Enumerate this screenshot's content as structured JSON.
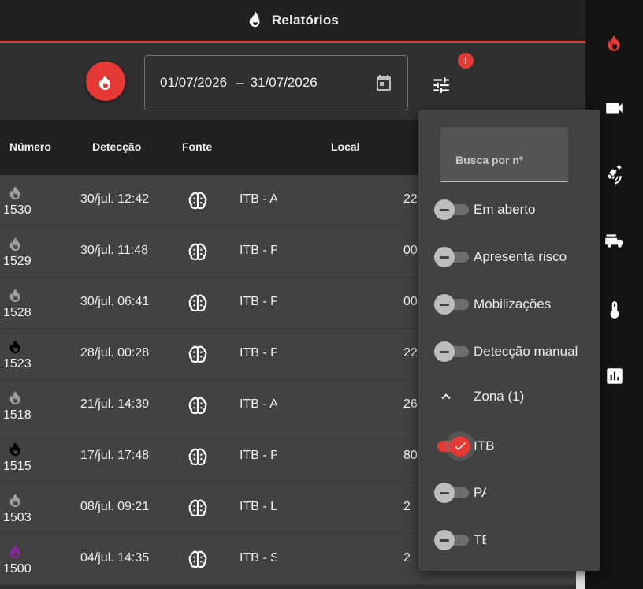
{
  "header": {
    "title": "Relatórios",
    "logo_icon": "fire-icon"
  },
  "rail": {
    "items": [
      {
        "icon": "fire-icon",
        "color": "#e53935"
      },
      {
        "icon": "video-camera-icon",
        "color": "#ffffff"
      },
      {
        "icon": "satellite-icon",
        "color": "#ffffff"
      },
      {
        "icon": "fire-truck-icon",
        "color": "#ffffff"
      },
      {
        "icon": "thermometer-icon",
        "color": "#ffffff"
      },
      {
        "icon": "bar-chart-icon",
        "color": "#ffffff"
      }
    ]
  },
  "filters": {
    "date_start": "01/07/2026",
    "date_separator": "–",
    "date_end": "31/07/2026",
    "alert_badge": "!"
  },
  "table": {
    "columns": [
      "Número",
      "Detecção",
      "Fonte",
      "Local"
    ],
    "rows": [
      {
        "number": "1530",
        "detection": "30/jul. 12:42",
        "location": "ITB - A",
        "extra": "22",
        "icon_color": "#9e9e9e"
      },
      {
        "number": "1529",
        "detection": "30/jul. 11:48",
        "location": "ITB - P.",
        "extra": "00",
        "icon_color": "#9e9e9e"
      },
      {
        "number": "1528",
        "detection": "30/jul. 06:41",
        "location": "ITB - P.",
        "extra": "00",
        "icon_color": "#9e9e9e"
      },
      {
        "number": "1523",
        "detection": "28/jul. 00:28",
        "location": "ITB - P.",
        "extra": "22",
        "icon_color": "#000000"
      },
      {
        "number": "1518",
        "detection": "21/jul. 14:39",
        "location": "ITB - A",
        "extra": "26",
        "icon_color": "#9e9e9e"
      },
      {
        "number": "1515",
        "detection": "17/jul. 17:48",
        "location": "ITB - P.",
        "extra": "80",
        "icon_color": "#000000"
      },
      {
        "number": "1503",
        "detection": "08/jul. 09:21",
        "location": "ITB - L.",
        "extra": "2",
        "icon_color": "#9e9e9e"
      },
      {
        "number": "1500",
        "detection": "04/jul. 14:35",
        "location": "ITB - S.",
        "extra": "2",
        "icon_color": "#8e24aa"
      }
    ]
  },
  "popup": {
    "search_placeholder": "Busca por nº",
    "toggles": [
      {
        "label": "Em aberto",
        "on": false
      },
      {
        "label": "Apresenta risco",
        "on": false
      },
      {
        "label": "Mobilizações",
        "on": false
      },
      {
        "label": "Detecção manual",
        "on": false
      }
    ],
    "zone_label": "Zona (1)",
    "zones": [
      {
        "label": "ITB",
        "on": true
      },
      {
        "label": "PA",
        "on": false
      },
      {
        "label": "TE",
        "on": false
      }
    ]
  },
  "colors": {
    "accent": "#e53935",
    "background": "#303030",
    "row": "#424242",
    "header": "#212121"
  }
}
